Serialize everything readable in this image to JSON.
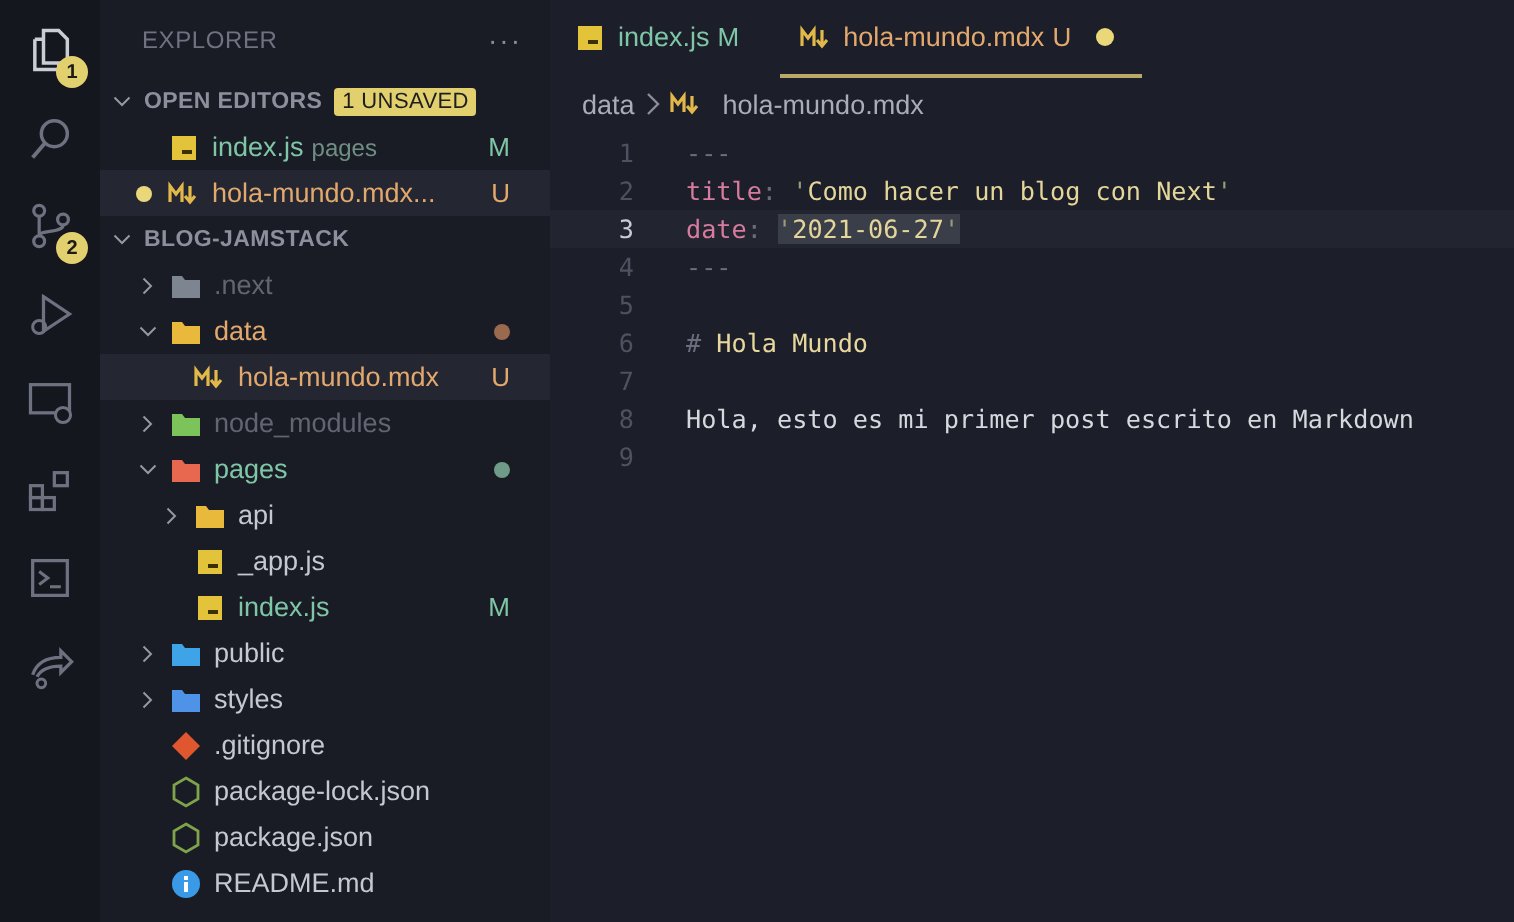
{
  "activity_bar": [
    {
      "kind": "files",
      "badge": "1",
      "selected": true
    },
    {
      "kind": "search",
      "selected": false
    },
    {
      "kind": "source-control",
      "badge": "2",
      "selected": false
    },
    {
      "kind": "run",
      "selected": false
    },
    {
      "kind": "remote",
      "selected": false
    },
    {
      "kind": "extensions",
      "selected": false
    },
    {
      "kind": "terminal",
      "selected": false
    },
    {
      "kind": "share",
      "selected": false
    }
  ],
  "sidebar": {
    "title": "EXPLORER",
    "more": "···",
    "open_editors": {
      "label": "OPEN EDITORS",
      "expanded": true,
      "badge": "1 UNSAVED",
      "items": [
        {
          "name": "index.js",
          "kind": "js",
          "dir": "pages",
          "modified": true,
          "untracked": false,
          "letter": "M",
          "dirty": false,
          "selected": false
        },
        {
          "name": "hola-mundo.mdx...",
          "kind": "md",
          "modified": false,
          "untracked": true,
          "letter": "U",
          "dirty": true,
          "selected": true
        }
      ]
    },
    "project": {
      "label": "BLOG-JAMSTACK",
      "expanded": true,
      "tree": [
        {
          "name": ".next",
          "kind": "folder",
          "color": "#7d8590",
          "expanded": false,
          "modified": false,
          "untracked": false,
          "ignored": true,
          "selected": false
        },
        {
          "name": "data",
          "kind": "folder",
          "color": "#e8b93b",
          "expanded": true,
          "modified": false,
          "untracked": true,
          "ignored": false,
          "dot": true,
          "selected": false,
          "children": [
            {
              "name": "hola-mundo.mdx",
              "kind": "md",
              "modified": false,
              "untracked": true,
              "ignored": false,
              "letter": "U",
              "selected": true
            }
          ]
        },
        {
          "name": "node_modules",
          "kind": "folder",
          "color": "#7cc45a",
          "expanded": false,
          "modified": false,
          "untracked": false,
          "ignored": true,
          "selected": false
        },
        {
          "name": "pages",
          "kind": "folder",
          "color": "#e8684f",
          "expanded": true,
          "modified": true,
          "untracked": false,
          "ignored": false,
          "dot": true,
          "selected": false,
          "children": [
            {
              "name": "api",
              "kind": "folder",
              "color": "#e8b93b",
              "expanded": false,
              "modified": false,
              "untracked": false,
              "ignored": false,
              "selected": false
            },
            {
              "name": "_app.js",
              "kind": "js",
              "modified": false,
              "untracked": false,
              "ignored": false,
              "selected": false
            },
            {
              "name": "index.js",
              "kind": "js",
              "modified": true,
              "untracked": false,
              "ignored": false,
              "letter": "M",
              "selected": false
            }
          ]
        },
        {
          "name": "public",
          "kind": "folder",
          "color": "#3fa3e8",
          "expanded": false,
          "modified": false,
          "untracked": false,
          "ignored": false,
          "selected": false
        },
        {
          "name": "styles",
          "kind": "folder",
          "color": "#4f93e8",
          "expanded": false,
          "modified": false,
          "untracked": false,
          "ignored": false,
          "selected": false
        },
        {
          "name": ".gitignore",
          "kind": "git",
          "modified": false,
          "untracked": false,
          "ignored": false,
          "selected": false
        },
        {
          "name": "package-lock.json",
          "kind": "node",
          "modified": false,
          "untracked": false,
          "ignored": false,
          "selected": false
        },
        {
          "name": "package.json",
          "kind": "node",
          "modified": false,
          "untracked": false,
          "ignored": false,
          "selected": false
        },
        {
          "name": "README.md",
          "kind": "info",
          "modified": false,
          "untracked": false,
          "ignored": false,
          "selected": false
        }
      ]
    }
  },
  "editor": {
    "tabs": [
      {
        "name": "index.js",
        "kind": "js",
        "modified": true,
        "untracked": false,
        "letter": "M",
        "dirty": false,
        "selected": false
      },
      {
        "name": "hola-mundo.mdx",
        "kind": "md",
        "modified": false,
        "untracked": true,
        "letter": "U",
        "dirty": true,
        "selected": true
      }
    ],
    "breadcrumb": [
      {
        "name": "data"
      },
      {
        "name": "hola-mundo.mdx",
        "kind": "md"
      }
    ],
    "lines": [
      {
        "number": "1",
        "current": false,
        "tokens": [
          {
            "kind": "punct",
            "text": "---"
          }
        ]
      },
      {
        "number": "2",
        "current": false,
        "tokens": [
          {
            "kind": "key",
            "text": "title"
          },
          {
            "kind": "punct",
            "text": ": "
          },
          {
            "kind": "quote",
            "text": "'"
          },
          {
            "kind": "string",
            "text": "Como hacer un blog con Next"
          },
          {
            "kind": "quote",
            "text": "'"
          }
        ]
      },
      {
        "number": "3",
        "current": true,
        "tokens": [
          {
            "kind": "key",
            "text": "date"
          },
          {
            "kind": "punct",
            "text": ": "
          },
          {
            "kind": "quote",
            "text": "'",
            "selected": true
          },
          {
            "kind": "string",
            "text": "2021-06-27",
            "selected": true
          },
          {
            "kind": "quote",
            "text": "'",
            "selected": true
          }
        ]
      },
      {
        "number": "4",
        "current": false,
        "tokens": [
          {
            "kind": "punct",
            "text": "---"
          }
        ]
      },
      {
        "number": "5",
        "current": false
      },
      {
        "number": "6",
        "current": false,
        "tokens": [
          {
            "kind": "heading-mark",
            "text": "# "
          },
          {
            "kind": "heading",
            "text": "Hola Mundo"
          }
        ]
      },
      {
        "number": "7",
        "current": false
      },
      {
        "number": "8",
        "current": false,
        "tokens": [
          {
            "kind": "text",
            "text": "Hola, esto es mi primer post escrito en Markdown"
          }
        ]
      },
      {
        "number": "9",
        "current": false
      }
    ]
  }
}
